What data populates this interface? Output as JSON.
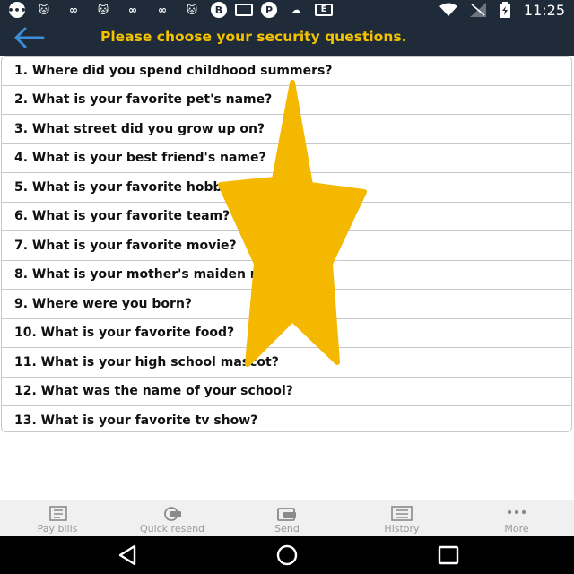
{
  "status_bar": {
    "time": "11:25",
    "notification_icons": [
      "message-icon",
      "cat-icon",
      "link-icon",
      "cat-icon",
      "link-icon",
      "link-icon",
      "cat-icon",
      "b-icon",
      "mail-icon",
      "pinterest-icon",
      "cloud-icon",
      "e-icon"
    ],
    "system_icons": [
      "wifi-icon",
      "signal-icon",
      "battery-icon"
    ]
  },
  "header": {
    "title": "Please choose your security questions."
  },
  "questions": [
    "1. Where did you spend childhood summers?",
    "2. What is your favorite pet's name?",
    "3. What street did you grow up on?",
    "4. What is your best friend's name?",
    "5. What is your favorite hobby?",
    "6. What is your favorite team?",
    "7. What is your favorite movie?",
    "8. What is your mother's maiden name?",
    "9. Where were you born?",
    "10. What is your favorite food?",
    "11. What is your high school mascot?",
    "12. What was the name of your school?",
    "13. What is your favorite tv show?"
  ],
  "bottom_nav": [
    {
      "label": "Pay bills",
      "icon": "pay-bills-icon"
    },
    {
      "label": "Quick resend",
      "icon": "quick-resend-icon"
    },
    {
      "label": "Send",
      "icon": "send-icon"
    },
    {
      "label": "History",
      "icon": "history-icon"
    },
    {
      "label": "More",
      "icon": "more-icon"
    }
  ],
  "colors": {
    "header_bg": "#1f2b38",
    "title_text": "#f3c200",
    "star_overlay": "#f5b800",
    "back_arrow": "#3b8ddb"
  }
}
